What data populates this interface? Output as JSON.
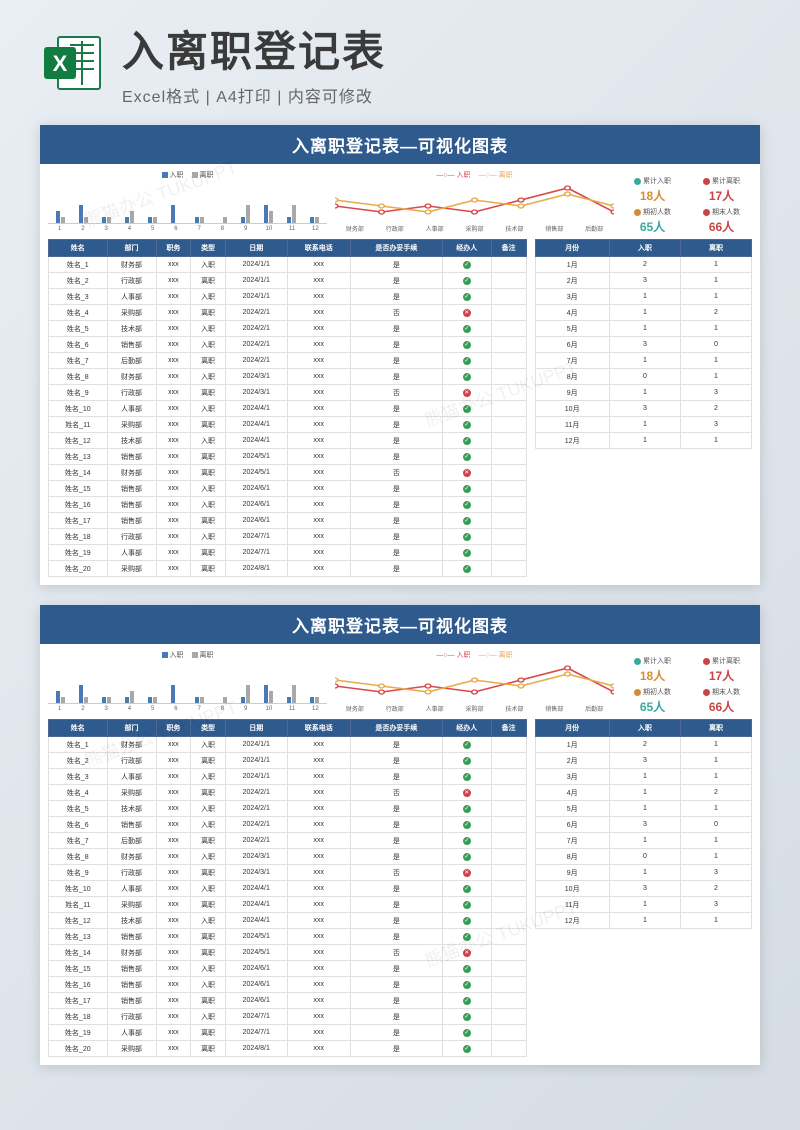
{
  "header": {
    "main_title": "入离职登记表",
    "subtitle_parts": [
      "Excel格式",
      "A4打印",
      "内容可修改"
    ],
    "excel_label": "X"
  },
  "sheet": {
    "title": "入离职登记表—可视化图表",
    "bar_legend": {
      "s1": "入职",
      "s2": "离职"
    },
    "line_legend": {
      "s1": "入职",
      "s2": "离职"
    },
    "line_x": [
      "财务部",
      "行政部",
      "人事部",
      "采购部",
      "技术部",
      "销售部",
      "后勤部"
    ],
    "stats": {
      "total_in": {
        "label": "累计入职",
        "value": "18人",
        "color": "#d98c2e",
        "dot": "#3aa89b"
      },
      "total_out": {
        "label": "累计离职",
        "value": "17人",
        "color": "#c94545",
        "dot": "#c94545"
      },
      "start": {
        "label": "期初人数",
        "value": "65人",
        "color": "#3aa89b",
        "dot": "#d98c2e"
      },
      "end": {
        "label": "期末人数",
        "value": "66人",
        "color": "#c94545",
        "dot": "#c94545"
      }
    },
    "main_cols": [
      "姓名",
      "部门",
      "职务",
      "类型",
      "日期",
      "联系电话",
      "是否办妥手续",
      "经办人",
      "备注"
    ],
    "main_rows": [
      [
        "姓名_1",
        "财务部",
        "xxx",
        "入职",
        "2024/1/1",
        "xxx",
        "是",
        "yes",
        ""
      ],
      [
        "姓名_2",
        "行政部",
        "xxx",
        "离职",
        "2024/1/1",
        "xxx",
        "是",
        "yes",
        ""
      ],
      [
        "姓名_3",
        "人事部",
        "xxx",
        "入职",
        "2024/1/1",
        "xxx",
        "是",
        "yes",
        ""
      ],
      [
        "姓名_4",
        "采购部",
        "xxx",
        "离职",
        "2024/2/1",
        "xxx",
        "否",
        "no",
        ""
      ],
      [
        "姓名_5",
        "技术部",
        "xxx",
        "入职",
        "2024/2/1",
        "xxx",
        "是",
        "yes",
        ""
      ],
      [
        "姓名_6",
        "销售部",
        "xxx",
        "入职",
        "2024/2/1",
        "xxx",
        "是",
        "yes",
        ""
      ],
      [
        "姓名_7",
        "后勤部",
        "xxx",
        "离职",
        "2024/2/1",
        "xxx",
        "是",
        "yes",
        ""
      ],
      [
        "姓名_8",
        "财务部",
        "xxx",
        "入职",
        "2024/3/1",
        "xxx",
        "是",
        "yes",
        ""
      ],
      [
        "姓名_9",
        "行政部",
        "xxx",
        "离职",
        "2024/3/1",
        "xxx",
        "否",
        "no",
        ""
      ],
      [
        "姓名_10",
        "人事部",
        "xxx",
        "入职",
        "2024/4/1",
        "xxx",
        "是",
        "yes",
        ""
      ],
      [
        "姓名_11",
        "采购部",
        "xxx",
        "离职",
        "2024/4/1",
        "xxx",
        "是",
        "yes",
        ""
      ],
      [
        "姓名_12",
        "技术部",
        "xxx",
        "入职",
        "2024/4/1",
        "xxx",
        "是",
        "yes",
        ""
      ],
      [
        "姓名_13",
        "销售部",
        "xxx",
        "离职",
        "2024/5/1",
        "xxx",
        "是",
        "yes",
        ""
      ],
      [
        "姓名_14",
        "财务部",
        "xxx",
        "离职",
        "2024/5/1",
        "xxx",
        "否",
        "no",
        ""
      ],
      [
        "姓名_15",
        "销售部",
        "xxx",
        "入职",
        "2024/6/1",
        "xxx",
        "是",
        "yes",
        ""
      ],
      [
        "姓名_16",
        "销售部",
        "xxx",
        "入职",
        "2024/6/1",
        "xxx",
        "是",
        "yes",
        ""
      ],
      [
        "姓名_17",
        "销售部",
        "xxx",
        "离职",
        "2024/6/1",
        "xxx",
        "是",
        "yes",
        ""
      ],
      [
        "姓名_18",
        "行政部",
        "xxx",
        "入职",
        "2024/7/1",
        "xxx",
        "是",
        "yes",
        ""
      ],
      [
        "姓名_19",
        "人事部",
        "xxx",
        "离职",
        "2024/7/1",
        "xxx",
        "是",
        "yes",
        ""
      ],
      [
        "姓名_20",
        "采购部",
        "xxx",
        "离职",
        "2024/8/1",
        "xxx",
        "是",
        "yes",
        ""
      ]
    ],
    "side_cols": [
      "月份",
      "入职",
      "离职"
    ],
    "side_rows": [
      [
        "1月",
        "2",
        "1"
      ],
      [
        "2月",
        "3",
        "1"
      ],
      [
        "3月",
        "1",
        "1"
      ],
      [
        "4月",
        "1",
        "2"
      ],
      [
        "5月",
        "1",
        "1"
      ],
      [
        "6月",
        "3",
        "0"
      ],
      [
        "7月",
        "1",
        "1"
      ],
      [
        "8月",
        "0",
        "1"
      ],
      [
        "9月",
        "1",
        "3"
      ],
      [
        "10月",
        "3",
        "2"
      ],
      [
        "11月",
        "1",
        "3"
      ],
      [
        "12月",
        "1",
        "1"
      ]
    ]
  },
  "chart_data": [
    {
      "type": "bar",
      "title": "月度入职离职",
      "categories": [
        "1",
        "2",
        "3",
        "4",
        "5",
        "6",
        "7",
        "8",
        "9",
        "10",
        "11",
        "12"
      ],
      "series": [
        {
          "name": "入职",
          "values": [
            2,
            3,
            1,
            1,
            1,
            3,
            1,
            0,
            1,
            3,
            1,
            1
          ]
        },
        {
          "name": "离职",
          "values": [
            1,
            1,
            1,
            2,
            1,
            0,
            1,
            1,
            3,
            2,
            3,
            1
          ]
        }
      ],
      "ylim": [
        0,
        7
      ]
    },
    {
      "type": "line",
      "title": "部门入职离职",
      "categories": [
        "财务部",
        "行政部",
        "人事部",
        "采购部",
        "技术部",
        "销售部",
        "后勤部"
      ],
      "series": [
        {
          "name": "入职",
          "values": [
            3,
            2,
            3,
            2,
            4,
            6,
            2
          ]
        },
        {
          "name": "离职",
          "values": [
            4,
            3,
            2,
            4,
            3,
            5,
            3
          ]
        }
      ],
      "ylim": [
        0,
        7
      ]
    }
  ],
  "watermark": "熊猫办公 TUKUPPT"
}
